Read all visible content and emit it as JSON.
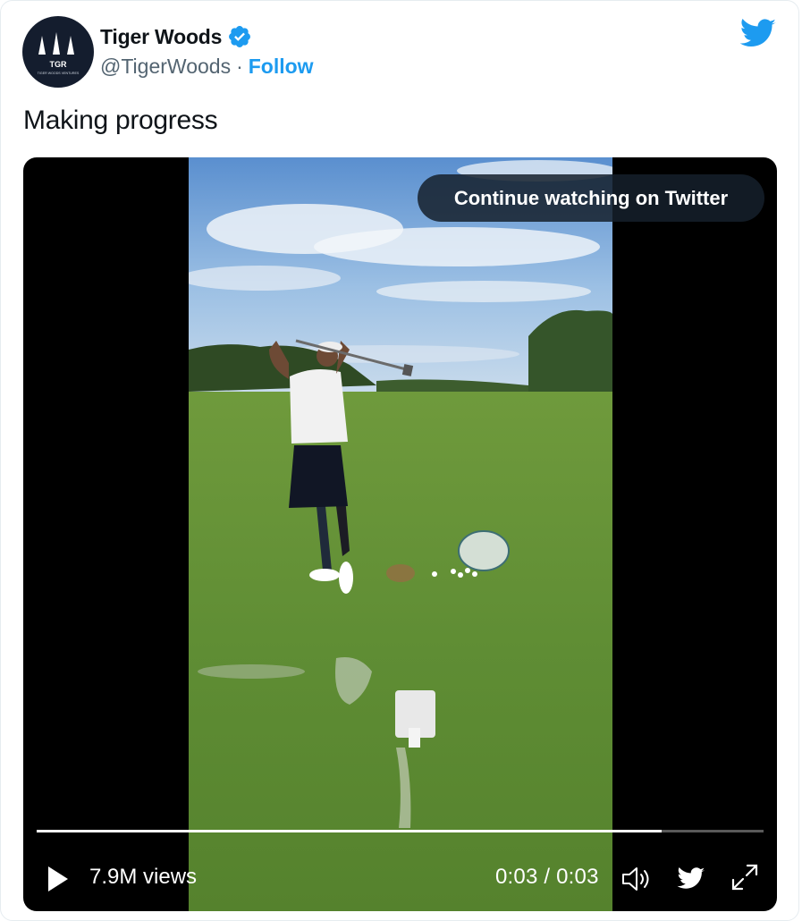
{
  "author": {
    "name": "Tiger Woods",
    "handle": "@TigerWoods",
    "separator": "·",
    "follow_label": "Follow",
    "avatar_text": "TGR",
    "avatar_subtext": "TIGER WOODS VENTURES"
  },
  "tweet": {
    "text": "Making progress"
  },
  "video": {
    "continue_label": "Continue watching on Twitter",
    "views": "7.9M views",
    "time": "0:03 / 0:03",
    "progress": 0.86
  },
  "icons": {
    "verified": "verified-badge-icon",
    "brand": "twitter-bird-icon",
    "play": "play-icon",
    "volume": "volume-icon",
    "fullscreen": "fullscreen-icon"
  },
  "colors": {
    "accent": "#1d9bf0",
    "text": "#0f1419",
    "muted": "#536471",
    "video_bg": "#000000"
  }
}
